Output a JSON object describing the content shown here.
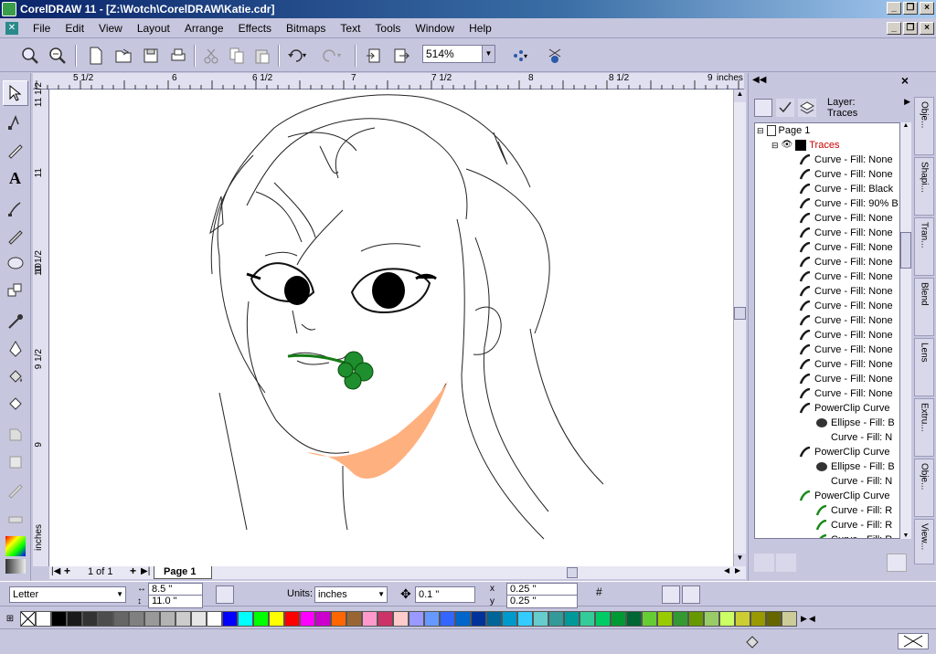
{
  "window": {
    "title": "CorelDRAW 11 - [Z:\\Wotch\\CorelDRAW\\Katie.cdr]"
  },
  "menu": [
    "File",
    "Edit",
    "View",
    "Layout",
    "Arrange",
    "Effects",
    "Bitmaps",
    "Text",
    "Tools",
    "Window",
    "Help"
  ],
  "toolbar": {
    "zoom": "514%"
  },
  "rulers": {
    "unit": "inches",
    "h_ticks": [
      "5 1/2",
      "6",
      "6 1/2",
      "7",
      "7 1/2",
      "8",
      "8 1/2",
      "9"
    ],
    "v_ticks": [
      "11 1/2",
      "11",
      "10 1/2",
      "10",
      "9 1/2",
      "9"
    ],
    "v_unit": "inches"
  },
  "pages": {
    "counter": "1 of 1",
    "tab": "Page 1"
  },
  "object_manager": {
    "layer_label": "Layer:",
    "layer_name": "Traces",
    "page": "Page 1",
    "layer": "Traces",
    "items": [
      {
        "label": "Curve - Fill: None",
        "level": 3,
        "color": "#1a1a1a"
      },
      {
        "label": "Curve - Fill: None",
        "level": 3,
        "color": "#1a1a1a"
      },
      {
        "label": "Curve - Fill: Black",
        "level": 3,
        "color": "#1a1a1a"
      },
      {
        "label": "Curve - Fill: 90% B",
        "level": 3,
        "color": "#1a1a1a"
      },
      {
        "label": "Curve - Fill: None",
        "level": 3,
        "color": "#1a1a1a"
      },
      {
        "label": "Curve - Fill: None",
        "level": 3,
        "color": "#1a1a1a"
      },
      {
        "label": "Curve - Fill: None",
        "level": 3,
        "color": "#1a1a1a"
      },
      {
        "label": "Curve - Fill: None",
        "level": 3,
        "color": "#1a1a1a"
      },
      {
        "label": "Curve - Fill: None",
        "level": 3,
        "color": "#1a1a1a"
      },
      {
        "label": "Curve - Fill: None",
        "level": 3,
        "color": "#1a1a1a"
      },
      {
        "label": "Curve - Fill: None",
        "level": 3,
        "color": "#1a1a1a"
      },
      {
        "label": "Curve - Fill: None",
        "level": 3,
        "color": "#1a1a1a"
      },
      {
        "label": "Curve - Fill: None",
        "level": 3,
        "color": "#1a1a1a"
      },
      {
        "label": "Curve - Fill: None",
        "level": 3,
        "color": "#1a1a1a"
      },
      {
        "label": "Curve - Fill: None",
        "level": 3,
        "color": "#1a1a1a"
      },
      {
        "label": "Curve - Fill: None",
        "level": 3,
        "color": "#1a1a1a"
      },
      {
        "label": "Curve - Fill: None",
        "level": 3,
        "color": "#1a1a1a"
      },
      {
        "label": "PowerClip Curve",
        "level": 3,
        "color": "#1a1a1a"
      },
      {
        "label": "Ellipse - Fill: B",
        "level": 4,
        "color": "#333"
      },
      {
        "label": "Curve - Fill: N",
        "level": 4,
        "color": "none"
      },
      {
        "label": "PowerClip Curve",
        "level": 3,
        "color": "#1a1a1a"
      },
      {
        "label": "Ellipse - Fill: B",
        "level": 4,
        "color": "#333"
      },
      {
        "label": "Curve - Fill: N",
        "level": 4,
        "color": "none"
      },
      {
        "label": "PowerClip Curve",
        "level": 3,
        "color": "#1a8a1a"
      },
      {
        "label": "Curve - Fill: R",
        "level": 4,
        "color": "#1a8a1a"
      },
      {
        "label": "Curve - Fill: R",
        "level": 4,
        "color": "#1a8a1a"
      },
      {
        "label": "Curve - Fill: R",
        "level": 4,
        "color": "#1a8a1a"
      }
    ]
  },
  "side_tabs": [
    "Obje...",
    "Shapi...",
    "Tran...",
    "Blend",
    "Lens",
    "Extru...",
    "Obje...",
    "View..."
  ],
  "property_bar": {
    "paper": "Letter",
    "width": "8.5 \"",
    "height": "11.0 \"",
    "units_label": "Units:",
    "units": "inches",
    "nudge": "0.1 \"",
    "dup_x": "0.25 \"",
    "dup_y": "0.25 \""
  },
  "palette": [
    "#ffffff",
    "#000000",
    "#1a1a1a",
    "#333333",
    "#4d4d4d",
    "#666666",
    "#808080",
    "#999999",
    "#b3b3b3",
    "#cccccc",
    "#e6e6e6",
    "#ffffff",
    "#0000ff",
    "#00ffff",
    "#00ff00",
    "#ffff00",
    "#ff0000",
    "#ff00ff",
    "#cc00cc",
    "#ff6600",
    "#996633",
    "#ff99cc",
    "#cc3366",
    "#ffcccc",
    "#9999ff",
    "#6699ff",
    "#3366ff",
    "#0066cc",
    "#003399",
    "#006699",
    "#0099cc",
    "#33ccff",
    "#66cccc",
    "#339999",
    "#009999",
    "#33cc99",
    "#00cc66",
    "#009933",
    "#006633",
    "#66cc33",
    "#99cc00",
    "#339933",
    "#669900",
    "#99cc66",
    "#ccff66",
    "#cccc33",
    "#999900",
    "#666600",
    "#cccc99"
  ]
}
